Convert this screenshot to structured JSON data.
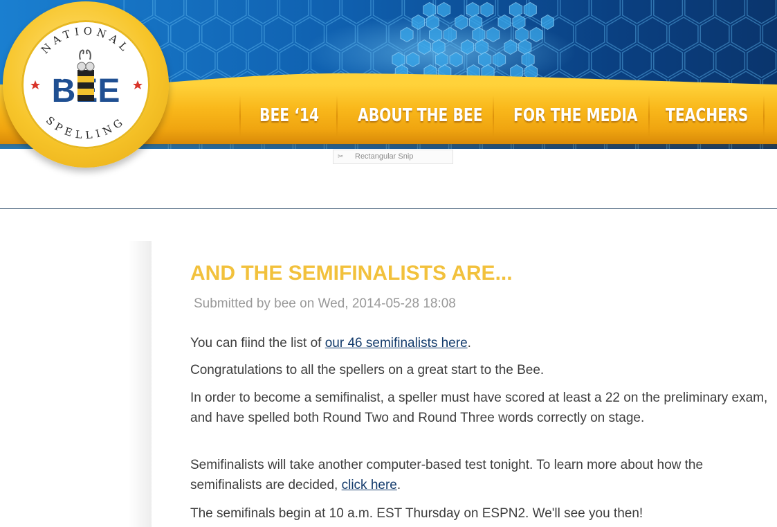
{
  "logo": {
    "ring_text_top": "NATIONAL",
    "ring_text_bottom": "SPELLING",
    "wordmark": "BEE"
  },
  "nav": {
    "items": [
      {
        "label": "BEE ‘14"
      },
      {
        "label": "ABOUT THE BEE"
      },
      {
        "label": "FOR THE MEDIA"
      },
      {
        "label": "TEACHERS"
      }
    ]
  },
  "snip_tooltip": {
    "icon": "scissors-icon",
    "label": "Rectangular Snip"
  },
  "article": {
    "title": "AND THE SEMIFINALISTS ARE...",
    "submitted": "Submitted by bee on Wed, 2014-05-28 18:08",
    "p1_before": "You can fiind the list of ",
    "p1_link": "our 46 semifinalists here",
    "p1_after": ".",
    "p2": "Congratulations to all the spellers on a great start to the Bee.",
    "p3": "In order to become a semifinalist, a speller must have scored at least a 22 on the preliminary exam, and have spelled both Round Two and Round Three words correctly on stage.",
    "p4_before": "Semifinalists will take another computer-based test tonight. To learn more about how the semifinalists are decided, ",
    "p4_link": "click here",
    "p4_after": ".",
    "p5": "The semifinals begin at 10 a.m. EST Thursday on ESPN2. We'll see you then!"
  },
  "colors": {
    "title": "#f2c13c",
    "link": "#123a6b",
    "nav_bar": "#f9b81b",
    "header_blue": "#0b4d8f"
  }
}
